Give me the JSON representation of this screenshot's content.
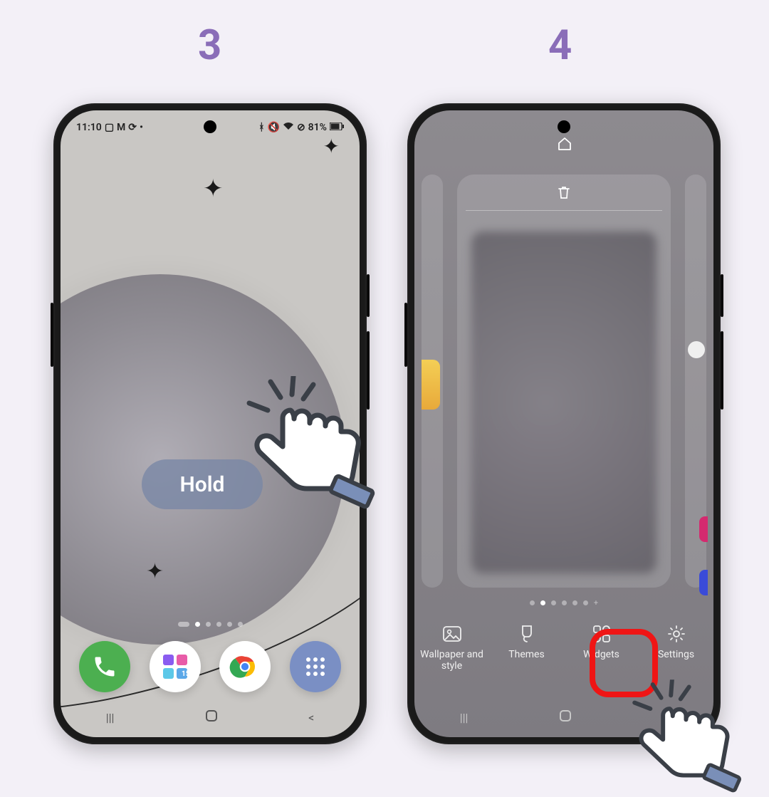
{
  "steps": {
    "left": "3",
    "right": "4"
  },
  "status": {
    "time": "11:10",
    "battery": "81%"
  },
  "hold_label": "Hold",
  "edit_options": {
    "wallpaper": "Wallpaper and style",
    "themes": "Themes",
    "widgets": "Widgets",
    "settings": "Settings"
  }
}
